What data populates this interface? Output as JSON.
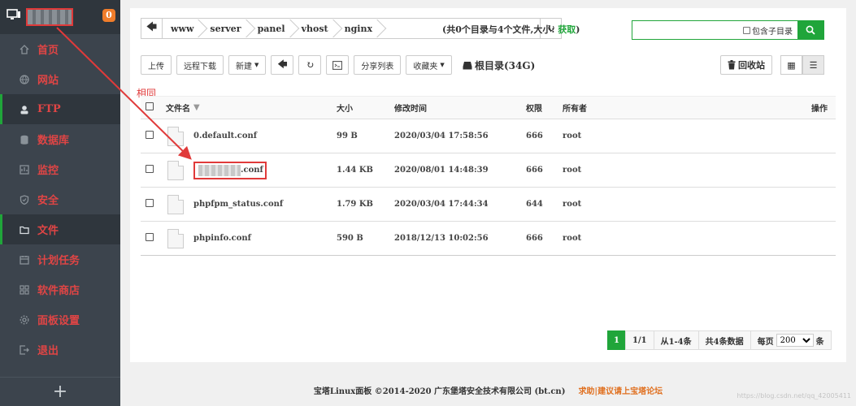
{
  "sidebar": {
    "badge": "0",
    "items": [
      {
        "label": "首页",
        "icon": "home-icon"
      },
      {
        "label": "网站",
        "icon": "globe-icon"
      },
      {
        "label": "FTP",
        "icon": "user-icon"
      },
      {
        "label": "数据库",
        "icon": "database-icon"
      },
      {
        "label": "监控",
        "icon": "monitor-icon"
      },
      {
        "label": "安全",
        "icon": "shield-icon"
      },
      {
        "label": "文件",
        "icon": "folder-icon"
      },
      {
        "label": "计划任务",
        "icon": "calendar-icon"
      },
      {
        "label": "软件商店",
        "icon": "grid-icon"
      },
      {
        "label": "面板设置",
        "icon": "gear-icon"
      },
      {
        "label": "退出",
        "icon": "logout-icon"
      }
    ],
    "add": "+"
  },
  "path": {
    "crumbs": [
      "www",
      "server",
      "panel",
      "vhost",
      "nginx"
    ],
    "summary_prefix": "(共0个目录与4个文件,大小: ",
    "summary_get": "获取",
    "summary_suffix": ")"
  },
  "search": {
    "include_sub": "包含子目录"
  },
  "toolbar": {
    "upload": "上传",
    "remote_download": "远程下载",
    "new": "新建",
    "share_list": "分享列表",
    "favorites": "收藏夹",
    "root_dir": "根目录(34G)",
    "recycle": "回收站"
  },
  "annotation": {
    "same": "相同"
  },
  "table": {
    "headers": {
      "name": "文件名",
      "size": "大小",
      "mtime": "修改时间",
      "perm": "权限",
      "owner": "所有者",
      "ops": "操作"
    },
    "rows": [
      {
        "name": "0.default.conf",
        "size": "99 B",
        "mtime": "2020/03/04 17:58:56",
        "perm": "666",
        "owner": "root"
      },
      {
        "name": ".conf",
        "size": "1.44 KB",
        "mtime": "2020/08/01 14:48:39",
        "perm": "666",
        "owner": "root"
      },
      {
        "name": "phpfpm_status.conf",
        "size": "1.79 KB",
        "mtime": "2020/03/04 17:44:34",
        "perm": "644",
        "owner": "root"
      },
      {
        "name": "phpinfo.conf",
        "size": "590 B",
        "mtime": "2018/12/13 10:02:56",
        "perm": "666",
        "owner": "root"
      }
    ]
  },
  "pager": {
    "current": "1",
    "pages": "1/1",
    "range": "从1-4条",
    "total": "共4条数据",
    "per_page_label": "每页",
    "per_page_value": "200",
    "unit": "条"
  },
  "footer": {
    "copyright": "宝塔Linux面板 ©2014-2020 广东堡塔安全技术有限公司 (bt.cn)",
    "help": "求助|建议请上宝塔论坛"
  },
  "watermark": "https://blog.csdn.net/qq_42005411",
  "colors": {
    "accent": "#20a53a",
    "sidebar_bg": "#3c444d",
    "sidebar_text": "#e04545",
    "annotation_red": "#e03a3a",
    "badge": "#f07d2b"
  }
}
